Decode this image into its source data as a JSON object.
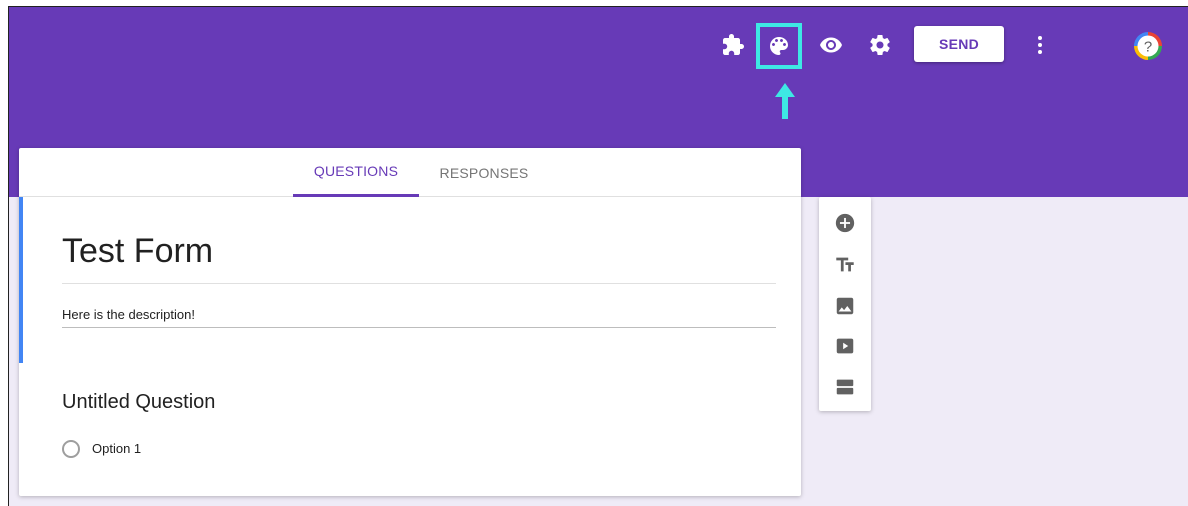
{
  "header": {
    "send_label": "SEND",
    "icons": [
      "puzzle-icon",
      "palette-icon",
      "eye-icon",
      "gear-icon",
      "more-vert-icon",
      "help-icon"
    ],
    "help_symbol": "?"
  },
  "tabs": [
    {
      "label": "QUESTIONS",
      "active": true
    },
    {
      "label": "RESPONSES",
      "active": false
    }
  ],
  "form": {
    "title": "Test Form",
    "description": "Here is the description!"
  },
  "question": {
    "title": "Untitled Question",
    "options": [
      "Option 1"
    ]
  },
  "side_toolbar": {
    "icons": [
      "add-circle-icon",
      "text-icon",
      "image-icon",
      "video-icon",
      "section-icon"
    ]
  },
  "colors": {
    "header": "#673ab7",
    "background": "#efebf7",
    "highlight": "#3ee8e4",
    "title_accent": "#4285f4"
  }
}
